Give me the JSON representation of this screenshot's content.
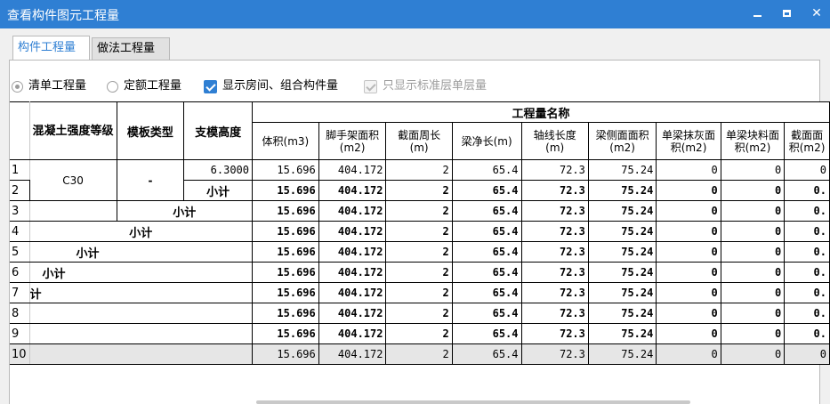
{
  "window": {
    "title": "查看构件图元工程量",
    "controls": {
      "minimize": "_",
      "maximize": "□",
      "close": "✕"
    },
    "accent_color": "#2f7fd3"
  },
  "tabs": [
    {
      "label": "构件工程量",
      "active": true
    },
    {
      "label": "做法工程量",
      "active": false
    }
  ],
  "options": {
    "bill_quantity": {
      "label": "清单工程量",
      "selected": true
    },
    "quota_quantity": {
      "label": "定额工程量",
      "selected": false
    },
    "show_rooms": {
      "label": "显示房间、组合构件量",
      "checked": true
    },
    "standard_floor_only": {
      "label": "只显示标准层单层量",
      "checked": true,
      "disabled": true
    }
  },
  "table": {
    "group_header": "工程量名称",
    "fixed_headers": [
      "混凝土强度等级",
      "模板类型",
      "支模高度"
    ],
    "columns": [
      "体积(m3)",
      "脚手架面积(m2)",
      "截面周长(m)",
      "梁净长(m)",
      "轴线长度(m)",
      "梁侧面面积(m2)",
      "单梁抹灰面积(m2)",
      "单梁块料面积(m2)",
      "截面面积(m2)"
    ],
    "rows": [
      {
        "no": "1",
        "grade": "C30",
        "formwork": "-",
        "height": "6.3000",
        "values": [
          "15.696",
          "404.172",
          "2",
          "65.4",
          "72.3",
          "75.24",
          "0",
          "0",
          "0"
        ]
      },
      {
        "no": "2",
        "label": "小计",
        "values": [
          "15.696",
          "404.172",
          "2",
          "65.4",
          "72.3",
          "75.24",
          "0",
          "0",
          "0."
        ]
      },
      {
        "no": "3",
        "label": "小计",
        "values": [
          "15.696",
          "404.172",
          "2",
          "65.4",
          "72.3",
          "75.24",
          "0",
          "0",
          "0."
        ]
      },
      {
        "no": "4",
        "label": "小计",
        "values": [
          "15.696",
          "404.172",
          "2",
          "65.4",
          "72.3",
          "75.24",
          "0",
          "0",
          "0."
        ]
      },
      {
        "no": "5",
        "label": "小计",
        "values": [
          "15.696",
          "404.172",
          "2",
          "65.4",
          "72.3",
          "75.24",
          "0",
          "0",
          "0."
        ]
      },
      {
        "no": "6",
        "label": "小计",
        "values": [
          "15.696",
          "404.172",
          "2",
          "65.4",
          "72.3",
          "75.24",
          "0",
          "0",
          "0."
        ]
      },
      {
        "no": "7",
        "label": "计",
        "values": [
          "15.696",
          "404.172",
          "2",
          "65.4",
          "72.3",
          "75.24",
          "0",
          "0",
          "0."
        ]
      },
      {
        "no": "8",
        "values": [
          "15.696",
          "404.172",
          "2",
          "65.4",
          "72.3",
          "75.24",
          "0",
          "0",
          "0."
        ]
      },
      {
        "no": "9",
        "values": [
          "15.696",
          "404.172",
          "2",
          "65.4",
          "72.3",
          "75.24",
          "0",
          "0",
          "0."
        ]
      },
      {
        "no": "10",
        "values": [
          "15.696",
          "404.172",
          "2",
          "65.4",
          "72.3",
          "75.24",
          "0",
          "0",
          "0"
        ]
      }
    ]
  }
}
